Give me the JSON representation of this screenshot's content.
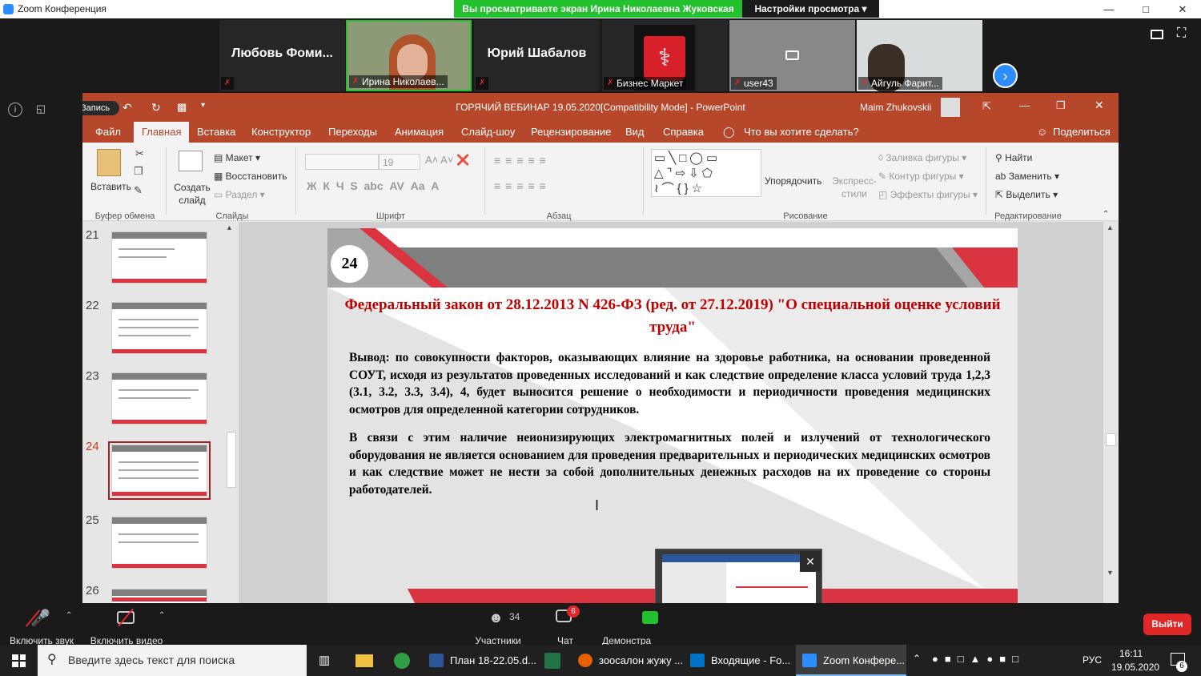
{
  "zoom": {
    "window_title": "Zoom Конференция",
    "share_banner": "Вы просматриваете экран Ирина Николаевна Жуковская",
    "view_options": "Настройки просмотра ▾",
    "participants": [
      {
        "big_name": "Любовь Фоми...",
        "label": ""
      },
      {
        "big_name": "",
        "label": "Ирина Николаев..."
      },
      {
        "big_name": "Юрий Шабалов",
        "label": ""
      },
      {
        "big_name": "",
        "label": "Бизнес Маркет"
      },
      {
        "big_name": "",
        "label": "user43"
      },
      {
        "big_name": "",
        "label": "Айгуль Фарит..."
      }
    ],
    "recording_label": "Запись",
    "bottom": {
      "audio": "Включить звук",
      "video": "Включить видео",
      "participants_count": "34",
      "participants": "Участники",
      "chat": "Чат",
      "chat_badge": "6",
      "share": "Демонстра",
      "leave": "Выйти"
    }
  },
  "ppt": {
    "title": "ГОРЯЧИЙ ВЕБИНАР 19.05.2020[Compatibility Mode]  -  PowerPoint",
    "user": "Maim Zhukovskii",
    "tabs": [
      "Файл",
      "Главная",
      "Вставка",
      "Конструктор",
      "Переходы",
      "Анимация",
      "Слайд-шоу",
      "Рецензирование",
      "Вид",
      "Справка",
      "Что вы хотите сделать?"
    ],
    "share": "Поделиться",
    "ribbon": {
      "paste": "Вставить",
      "clipboard_group": "Буфер обмена",
      "create_slide": "Создать слайд",
      "layout": "Макет",
      "reset": "Восстановить",
      "section": "Раздел",
      "slides_group": "Слайды",
      "font_size": "19",
      "font_group": "Шрифт",
      "para_group": "Абзац",
      "arrange": "Упорядочить",
      "express_styles": "Экспресс-стили",
      "fill": "Заливка фигуры",
      "outline": "Контур фигуры",
      "effects": "Эффекты фигуры",
      "drawing_group": "Рисование",
      "find": "Найти",
      "replace": "Заменить",
      "select": "Выделить",
      "edit_group": "Редактирование"
    },
    "thumb_numbers": [
      "21",
      "22",
      "23",
      "24",
      "25",
      "26"
    ]
  },
  "slide": {
    "number": "24",
    "title": "Федеральный закон от 28.12.2013 N 426-ФЗ (ред. от 27.12.2019) \"О специальной оценке условий труда\"",
    "para1": "Вывод:  по совокупности факторов, оказывающих влияние на здоровье работника, на основании проведенной СОУТ, исходя из результатов проведенных исследований и как следствие определение класса условий труда 1,2,3 (3.1, 3.2, 3.3, 3.4), 4, будет выносится решение о необходимости и периодичности проведения медицинских осмотров для определенной категории сотрудников.",
    "para2": "В связи с этим наличие неионизирующих электромагнитных полей и излучений от технологического оборудования не является основанием для проведения предварительных и периодических медицинских осмотров и как следствие может не нести за собой дополнительных денежных расходов на их проведение со стороны работодателей."
  },
  "taskbar": {
    "search_placeholder": "Введите здесь текст для поиска",
    "apps": [
      "План 18-22.05.d...",
      "зоосалон жужу ...",
      "Входящие - Fo...",
      "Zoom Конфере..."
    ],
    "lang": "РУС",
    "time": "16:11",
    "date": "19.05.2020",
    "notif": "6"
  }
}
